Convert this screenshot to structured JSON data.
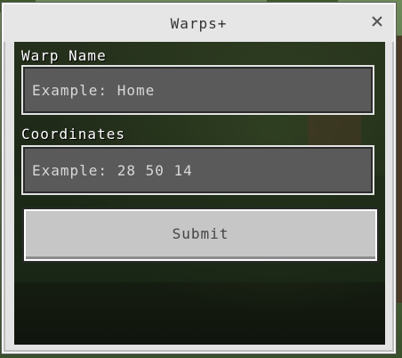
{
  "window": {
    "title": "Warps+",
    "close_icon": "close-icon"
  },
  "form": {
    "warp_name": {
      "label": "Warp Name",
      "placeholder": "Example: Home",
      "value": ""
    },
    "coordinates": {
      "label": "Coordinates",
      "placeholder": "Example: 28 50 14",
      "value": ""
    },
    "submit_label": "Submit"
  },
  "colors": {
    "dialog_bg": "#e3e3e3",
    "field_bg": "#5a5a5a",
    "button_bg": "#c6c6c6",
    "label_text": "#ffffff"
  }
}
